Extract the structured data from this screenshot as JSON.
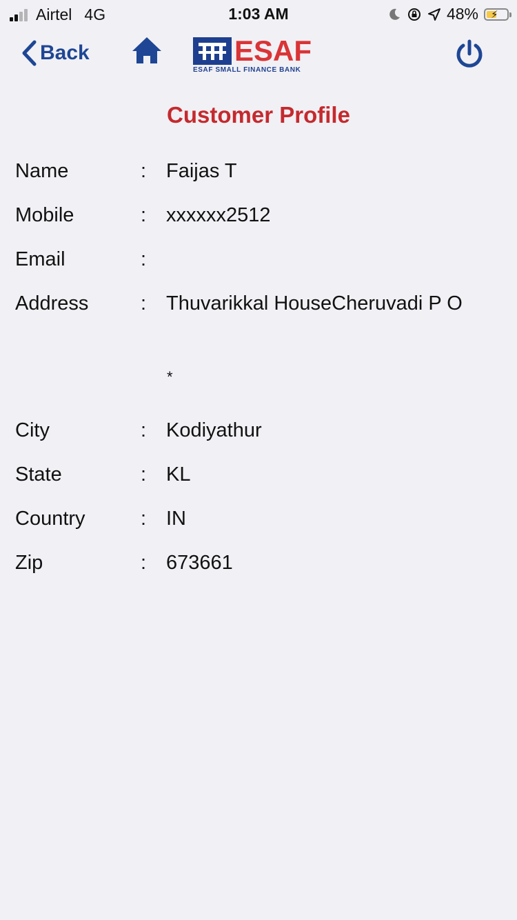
{
  "status_bar": {
    "carrier": "Airtel",
    "network": "4G",
    "time": "1:03 AM",
    "battery": "48%",
    "icons": [
      "signal-icon",
      "moon-icon",
      "rotation-lock-icon",
      "location-icon",
      "battery-icon"
    ]
  },
  "nav": {
    "back_label": "Back",
    "home_icon": "home-icon",
    "power_icon": "power-icon",
    "logo": {
      "word": "ESAF",
      "subtitle": "ESAF SMALL FINANCE BANK"
    }
  },
  "page": {
    "title": "Customer Profile"
  },
  "profile": {
    "separator": ":",
    "fields": [
      {
        "label": "Name",
        "value": "Faijas T"
      },
      {
        "label": "Mobile",
        "value": "xxxxxx2512"
      },
      {
        "label": "Email",
        "value": ""
      },
      {
        "label": "Address",
        "value": "Thuvarikkal HouseCheruvadi P O",
        "extra": "*"
      },
      {
        "label": "City",
        "value": "Kodiyathur"
      },
      {
        "label": "State",
        "value": "KL"
      },
      {
        "label": "Country",
        "value": "IN"
      },
      {
        "label": "Zip",
        "value": "673661"
      }
    ]
  },
  "colors": {
    "brand_blue": "#1e4695",
    "brand_red": "#c42a2e",
    "background": "#f1f0f4"
  }
}
